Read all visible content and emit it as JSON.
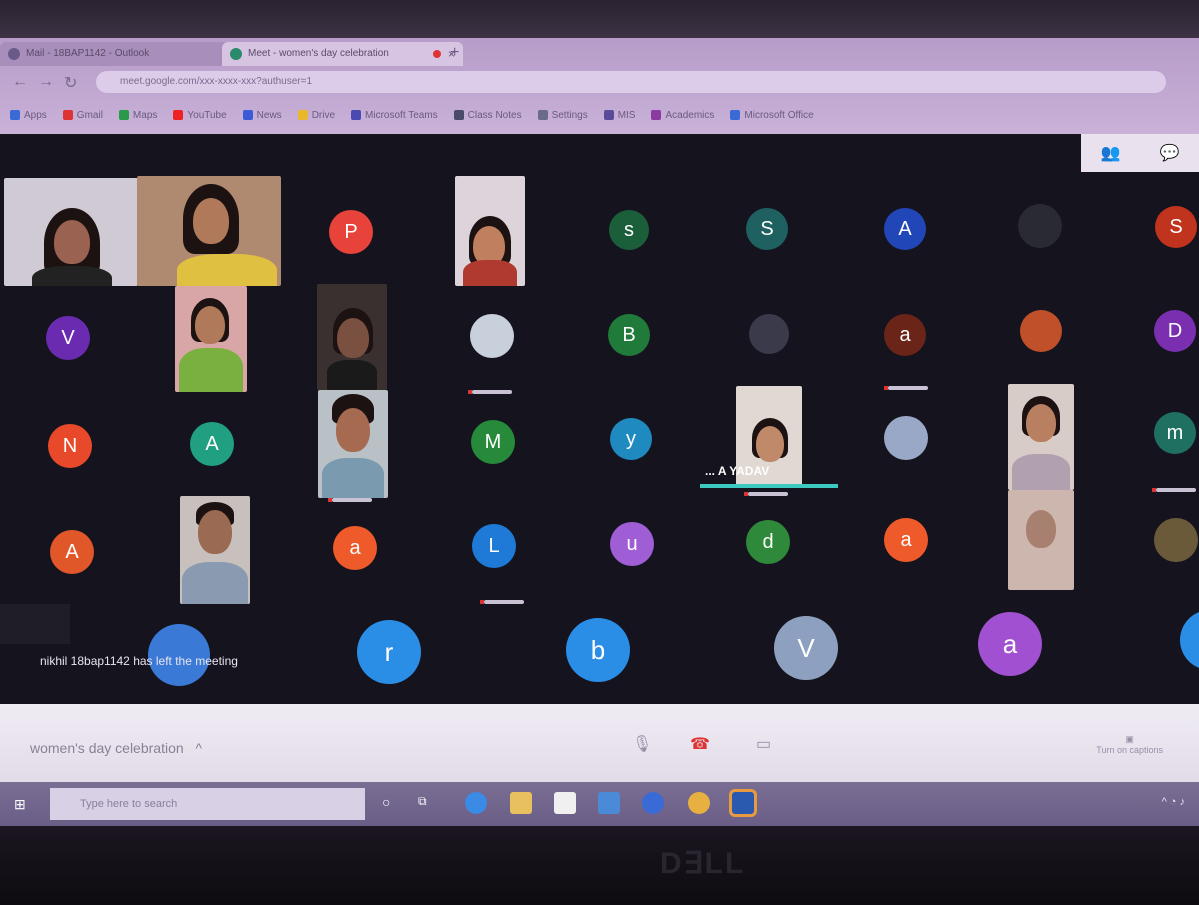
{
  "browser": {
    "tabs": [
      {
        "label": "Mail - 18BAP1142 - Outlook"
      },
      {
        "label": "Meet - women's day celebration"
      }
    ],
    "url": "meet.google.com/xxx-xxxx-xxx?authuser=1",
    "bookmarks": [
      "Apps",
      "Gmail",
      "Maps",
      "YouTube",
      "News",
      "Drive",
      "Microsoft Teams",
      "Class Notes",
      "Settings",
      "MIS",
      "Academics",
      "Microsoft Office"
    ]
  },
  "meeting": {
    "title": "women's day celebration",
    "toast": "nikhil 18bap1142 has left the meeting",
    "speaker_name": "... A YADAV",
    "captions_label": "Turn on captions",
    "participants": [
      {
        "letter": "P",
        "color": "#e8433a"
      },
      {
        "letter": "s",
        "color": "#1b5e3a"
      },
      {
        "letter": "S",
        "color": "#1f6060"
      },
      {
        "letter": "A",
        "color": "#2046b8"
      },
      {
        "letter": "S",
        "color": "#c0341d"
      },
      {
        "letter": "V",
        "color": "#6a2bb0"
      },
      {
        "letter": "B",
        "color": "#207a3a"
      },
      {
        "letter": "a",
        "color": "#6a2418"
      },
      {
        "letter": "D",
        "color": "#7a2fb0"
      },
      {
        "letter": "N",
        "color": "#e8492a"
      },
      {
        "letter": "A",
        "color": "#20a080"
      },
      {
        "letter": "M",
        "color": "#268a3a"
      },
      {
        "letter": "y",
        "color": "#1f8abf"
      },
      {
        "letter": "m",
        "color": "#1f7060"
      },
      {
        "letter": "A",
        "color": "#e0572a"
      },
      {
        "letter": "a",
        "color": "#ee5a2a"
      },
      {
        "letter": "L",
        "color": "#1e7ad6"
      },
      {
        "letter": "u",
        "color": "#a05ed6"
      },
      {
        "letter": "d",
        "color": "#2e8a3a"
      },
      {
        "letter": "a",
        "color": "#ee5a2a"
      },
      {
        "letter": "r",
        "color": "#2a8de6"
      },
      {
        "letter": "b",
        "color": "#2a8de6"
      },
      {
        "letter": "V",
        "color": "#8ea0c0"
      },
      {
        "letter": "a",
        "color": "#a050d0"
      }
    ]
  },
  "taskbar": {
    "search_placeholder": "Type here to search"
  },
  "laptop": {
    "brand": "DELL"
  }
}
